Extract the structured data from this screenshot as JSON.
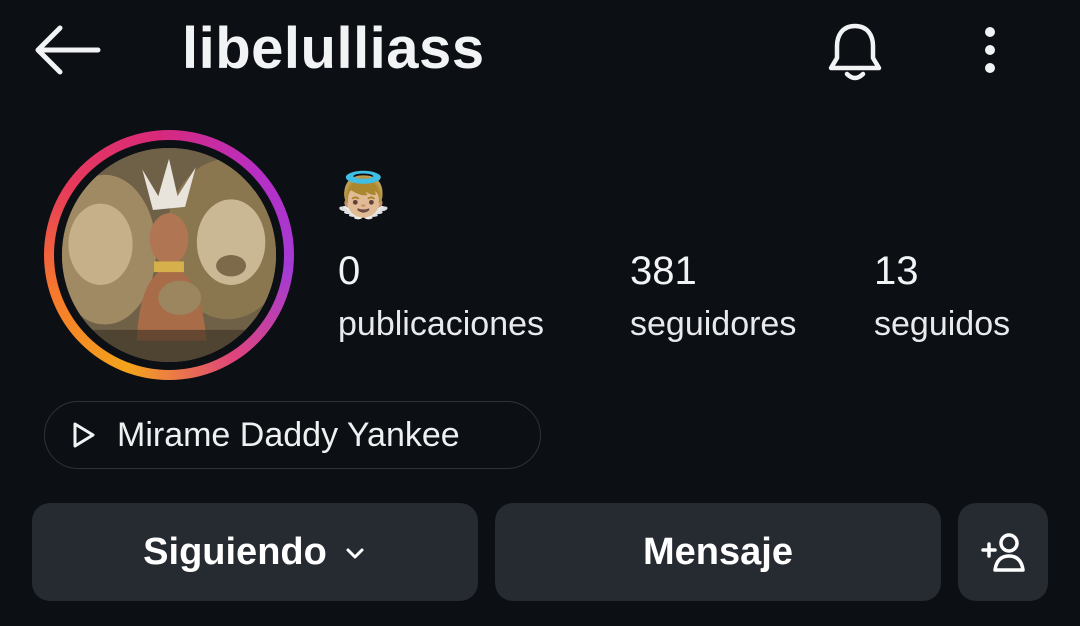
{
  "header": {
    "username": "libelulliass",
    "back_icon": "arrow-left-icon",
    "bell_icon": "bell-icon",
    "more_icon": "vertical-dots-icon"
  },
  "profile": {
    "avatar": "story-ring-avatar",
    "bio_emoji": "👼🏼",
    "stats": [
      {
        "value": "0",
        "label": "publicaciones"
      },
      {
        "value": "381",
        "label": "seguidores"
      },
      {
        "value": "13",
        "label": "seguidos"
      }
    ]
  },
  "music": {
    "icon": "play-icon",
    "song": "Mirame Daddy Yankee"
  },
  "actions": {
    "following_label": "Siguiendo",
    "message_label": "Mensaje",
    "add_icon": "add-person-icon"
  },
  "colors": {
    "background": "#0c0f14",
    "button_bg": "#262a31",
    "text": "#f2f3f5"
  }
}
